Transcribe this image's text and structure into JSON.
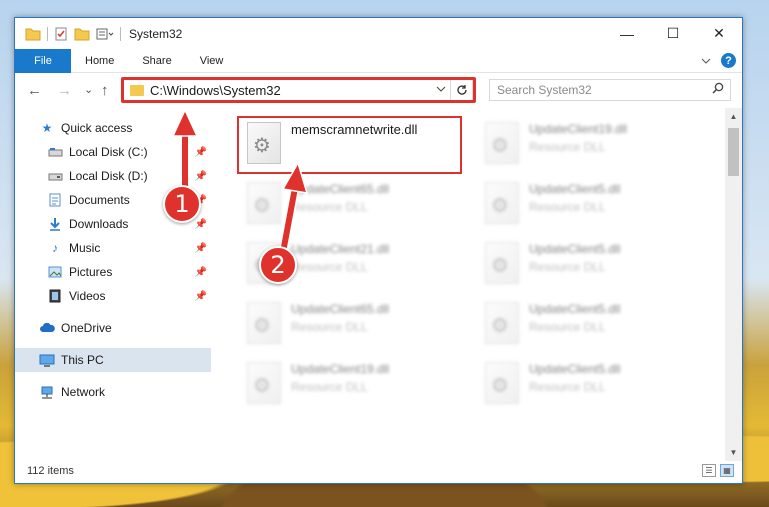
{
  "window": {
    "title": "System32",
    "controls": {
      "minimize": "—",
      "maximize": "☐",
      "close": "✕"
    }
  },
  "ribbon": {
    "file_tab": "File",
    "tabs": [
      "Home",
      "Share",
      "View"
    ],
    "help": "?"
  },
  "navigation": {
    "back": "←",
    "forward": "→",
    "recent": "⌄",
    "up": "↑",
    "address": "C:\\Windows\\System32",
    "search_placeholder": "Search System32"
  },
  "sidebar": {
    "items": [
      {
        "label": "Quick access",
        "icon": "star-icon",
        "level": 0
      },
      {
        "label": "Local Disk (C:)",
        "icon": "drive-icon",
        "level": 1,
        "pinned": true
      },
      {
        "label": "Local Disk (D:)",
        "icon": "drive-icon",
        "level": 1,
        "pinned": true
      },
      {
        "label": "Documents",
        "icon": "documents-icon",
        "level": 1,
        "pinned": true
      },
      {
        "label": "Downloads",
        "icon": "download-icon",
        "level": 1,
        "pinned": true
      },
      {
        "label": "Music",
        "icon": "music-icon",
        "level": 1,
        "pinned": true
      },
      {
        "label": "Pictures",
        "icon": "pictures-icon",
        "level": 1,
        "pinned": true
      },
      {
        "label": "Videos",
        "icon": "videos-icon",
        "level": 1,
        "pinned": true
      },
      {
        "label": "OneDrive",
        "icon": "cloud-icon",
        "level": 0
      },
      {
        "label": "This PC",
        "icon": "computer-icon",
        "level": 0,
        "selected": true
      },
      {
        "label": "Network",
        "icon": "network-icon",
        "level": 0
      }
    ]
  },
  "files": {
    "selected": {
      "name": "memscramnetwrite.dll"
    },
    "left_column": [
      {
        "name": "UpdateClient65.dll",
        "type": "Resource DLL"
      },
      {
        "name": "UpdateClient21.dll",
        "type": "Resource DLL"
      },
      {
        "name": "UpdateClient65.dll",
        "type": "Resource DLL"
      },
      {
        "name": "UpdateClient19.dll",
        "type": "Resource DLL"
      }
    ],
    "right_column": [
      {
        "name": "UpdateClient19.dll",
        "type": "Resource DLL"
      },
      {
        "name": "UpdateClient5.dll",
        "type": "Resource DLL"
      },
      {
        "name": "UpdateClient5.dll",
        "type": "Resource DLL"
      },
      {
        "name": "UpdateClient5.dll",
        "type": "Resource DLL"
      },
      {
        "name": "UpdateClient5.dll",
        "type": "Resource DLL"
      }
    ]
  },
  "status": {
    "item_count": "112 items"
  },
  "callouts": {
    "one": "1",
    "two": "2"
  },
  "colors": {
    "accent": "#1979ca",
    "highlight": "#e0322d",
    "selected_bg": "#d9e4ef"
  }
}
